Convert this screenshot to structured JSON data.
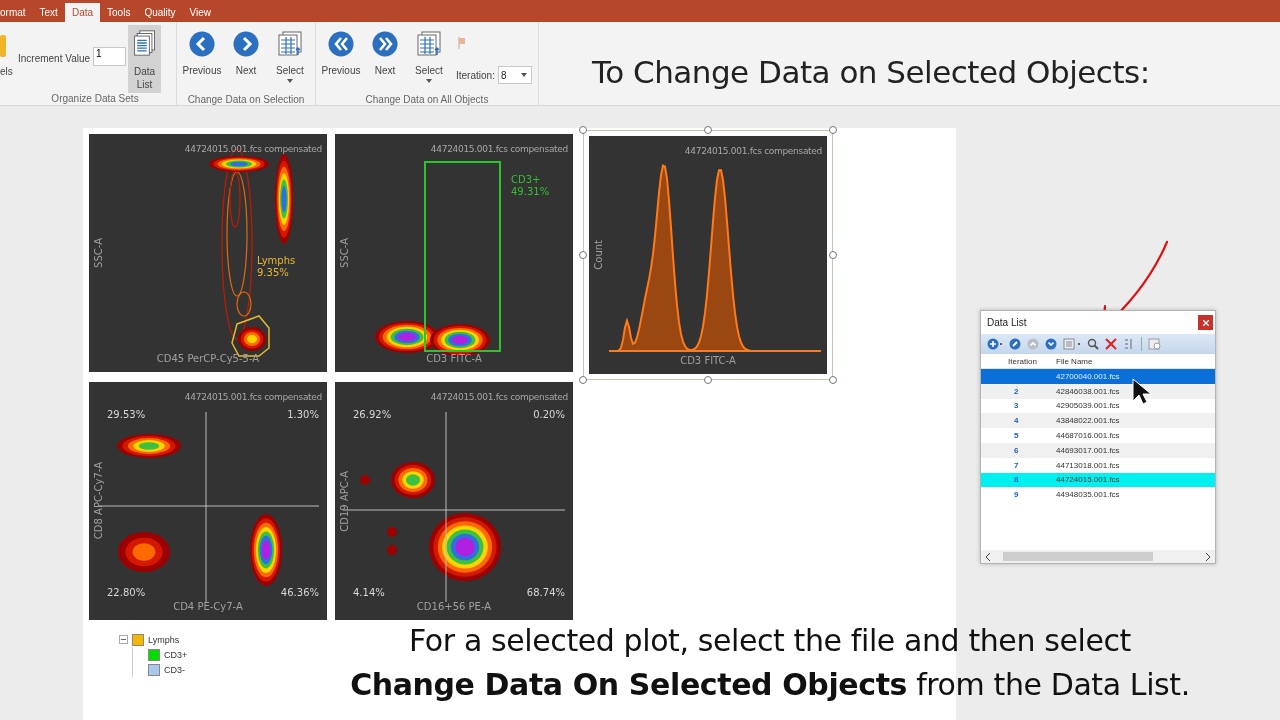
{
  "ribbon": {
    "tabs": [
      {
        "label": "ormat",
        "selected": false
      },
      {
        "label": "Text",
        "selected": false
      },
      {
        "label": "Data",
        "selected": true
      },
      {
        "label": "Tools",
        "selected": false
      },
      {
        "label": "Quality",
        "selected": false
      },
      {
        "label": "View",
        "selected": false
      }
    ],
    "cut_group": {
      "label": "els"
    },
    "organize": {
      "increment_label": "Increment Value",
      "increment_value": "1",
      "data_list_button": {
        "label": "Data List",
        "pressed": true
      },
      "group_label": "Organize Data Sets"
    },
    "selection_group": {
      "buttons": [
        {
          "kind": "previous",
          "label": "Previous"
        },
        {
          "kind": "next",
          "label": "Next"
        },
        {
          "kind": "select",
          "label": "Select"
        }
      ],
      "group_label": "Change Data on Selection"
    },
    "all_group": {
      "buttons": [
        {
          "kind": "first",
          "label": "Previous"
        },
        {
          "kind": "last",
          "label": "Next"
        },
        {
          "kind": "select",
          "label": "Select"
        }
      ],
      "iteration_label": "Iteration:",
      "iteration_value": "8",
      "group_label": "Change Data on All Objects"
    }
  },
  "captions": {
    "top": "To Change Data on Selected Objects:",
    "bottom_lines": [
      "For a selected plot, select the file and then select",
      "**Change Data On Selected Objects** from the Data List."
    ]
  },
  "plots": [
    {
      "kind": "contour",
      "file": "44724015.001.fcs compensated",
      "x_label": "CD45 PerCP-Cy5-5-A",
      "y_label": "SSC-A",
      "gate": {
        "kind": "polygon",
        "name": "Lymphs",
        "percent": "9.35%",
        "color": "#e8b830"
      },
      "selected": false
    },
    {
      "kind": "contour",
      "file": "44724015.001.fcs compensated",
      "x_label": "CD3 FITC-A",
      "y_label": "SSC-A",
      "gate": {
        "kind": "rectangle",
        "name": "CD3+",
        "percent": "49.31%",
        "color": "#2ec22e"
      },
      "selected": false
    },
    {
      "kind": "histogram",
      "file": "44724015.001.fcs compensated",
      "x_label": "CD3 FITC-A",
      "y_label": "Count",
      "selected": true
    },
    {
      "kind": "quadrant",
      "file": "44724015.001.fcs compensated",
      "x_label": "CD4 PE-Cy7-A",
      "y_label": "CD8 APC-Cy7-A",
      "quadrants": [
        "29.53%",
        "1.30%",
        "22.80%",
        "46.36%"
      ],
      "selected": false
    },
    {
      "kind": "quadrant",
      "file": "44724015.001.fcs compensated",
      "x_label": "CD16+56 PE-A",
      "y_label": "CD19 APC-A",
      "quadrants": [
        "26.92%",
        "0.20%",
        "4.14%",
        "68.74%"
      ],
      "selected": false
    }
  ],
  "gate_tree": [
    {
      "name": "Lymphs",
      "color": "#f5b800",
      "expanded": true,
      "children": [
        {
          "name": "CD3+",
          "color": "#00dd00"
        },
        {
          "name": "CD3-",
          "color": "#a8c8f0"
        }
      ]
    }
  ],
  "data_list": {
    "title": "Data List",
    "columns": [
      "Iteration",
      "File Name"
    ],
    "rows": [
      {
        "file": "42700040.001.fcs",
        "selected": true,
        "current": false
      },
      {
        "iteration": "2",
        "file": "42846038.001.fcs",
        "selected": false,
        "current": false
      },
      {
        "iteration": "3",
        "file": "42905039.001.fcs",
        "selected": false,
        "current": false
      },
      {
        "iteration": "4",
        "file": "43848022.001.fcs",
        "selected": false,
        "current": false
      },
      {
        "iteration": "5",
        "file": "44687016.001.fcs",
        "selected": false,
        "current": false
      },
      {
        "iteration": "6",
        "file": "44693017.001.fcs",
        "selected": false,
        "current": false
      },
      {
        "iteration": "7",
        "file": "44713018.001.fcs",
        "selected": false,
        "current": false
      },
      {
        "iteration": "8",
        "file": "44724015.001.fcs",
        "selected": false,
        "current": true
      },
      {
        "iteration": "9",
        "file": "44948035.001.fcs",
        "selected": false,
        "current": false
      }
    ]
  }
}
